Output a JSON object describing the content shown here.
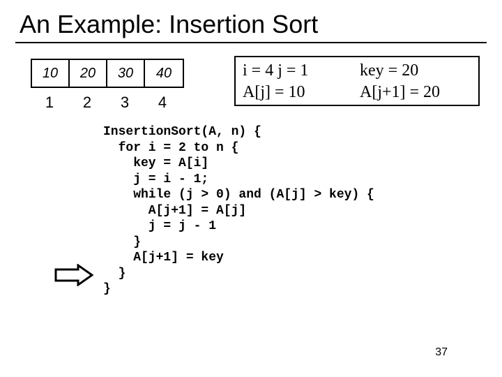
{
  "title": "An Example: Insertion Sort",
  "array": {
    "cells": [
      "10",
      "20",
      "30",
      "40"
    ],
    "indices": [
      "1",
      "2",
      "3",
      "4"
    ]
  },
  "status": {
    "line1_left": "i = 4    j = 1",
    "line1_right": "key = 20",
    "line2_left": "A[j] = 10",
    "line2_right": "A[j+1] = 20"
  },
  "code": "InsertionSort(A, n) {\n  for i = 2 to n {\n    key = A[i]\n    j = i - 1;\n    while (j > 0) and (A[j] > key) {\n      A[j+1] = A[j]\n      j = j - 1\n    }\n    A[j+1] = key\n  }\n}",
  "page_number": "37"
}
